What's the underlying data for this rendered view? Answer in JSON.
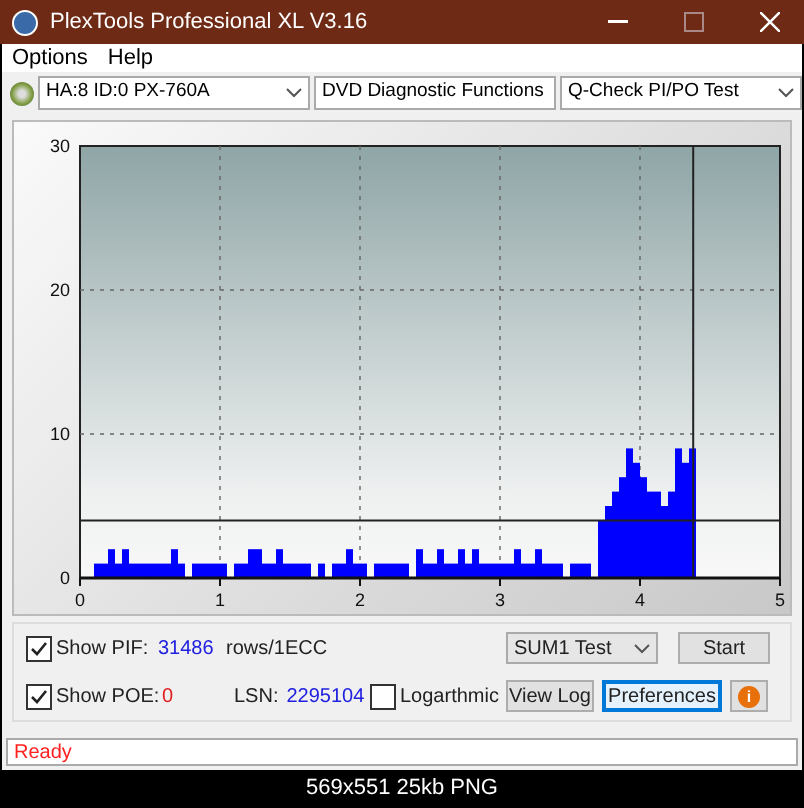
{
  "window": {
    "title": "PlexTools Professional XL V3.16"
  },
  "menu": [
    "Options",
    "Help"
  ],
  "toolbar": {
    "dropdowns": [
      "HA:8 ID:0  PX-760A",
      "DVD Diagnostic Functions",
      "Q-Check PI/PO Test"
    ]
  },
  "chart": {
    "chart_data": {
      "type": "bar",
      "xlim": [
        0,
        5
      ],
      "ylim": [
        0,
        30
      ],
      "xticks": [
        0,
        1,
        2,
        3,
        4,
        5
      ],
      "yticks": [
        0,
        10,
        20,
        30
      ],
      "x": [
        0,
        0.05,
        0.1,
        0.15,
        0.2,
        0.25,
        0.3,
        0.35,
        0.4,
        0.45,
        0.5,
        0.55,
        0.6,
        0.65,
        0.7,
        0.75,
        0.8,
        0.85,
        0.9,
        0.95,
        1,
        1.05,
        1.1,
        1.15,
        1.2,
        1.25,
        1.3,
        1.35,
        1.4,
        1.45,
        1.5,
        1.55,
        1.6,
        1.65,
        1.7,
        1.75,
        1.8,
        1.85,
        1.9,
        1.95,
        2,
        2.05,
        2.1,
        2.15,
        2.2,
        2.25,
        2.3,
        2.35,
        2.4,
        2.45,
        2.5,
        2.55,
        2.6,
        2.65,
        2.7,
        2.75,
        2.8,
        2.85,
        2.9,
        2.95,
        3,
        3.05,
        3.1,
        3.15,
        3.2,
        3.25,
        3.3,
        3.35,
        3.4,
        3.45,
        3.5,
        3.55,
        3.6,
        3.65,
        3.7,
        3.75,
        3.8,
        3.85,
        3.9,
        3.95,
        4,
        4.05,
        4.1,
        4.15,
        4.2,
        4.25,
        4.3,
        4.35
      ],
      "series": [
        {
          "color": "#0000ff",
          "values": [
            0,
            0,
            1,
            1,
            2,
            1,
            2,
            1,
            1,
            1,
            1,
            1,
            1,
            2,
            1,
            0,
            1,
            1,
            1,
            1,
            1,
            0,
            1,
            1,
            2,
            2,
            1,
            1,
            2,
            1,
            1,
            1,
            1,
            0,
            1,
            0,
            1,
            1,
            2,
            1,
            1,
            0,
            1,
            1,
            1,
            1,
            1,
            0,
            2,
            1,
            1,
            2,
            1,
            1,
            2,
            1,
            2,
            1,
            1,
            1,
            1,
            1,
            2,
            1,
            1,
            2,
            1,
            1,
            1,
            0,
            1,
            1,
            1,
            0,
            4,
            5,
            6,
            7,
            9,
            8,
            7,
            6,
            6,
            5,
            6,
            9,
            8,
            9
          ]
        }
      ],
      "grid": true,
      "ref_lines": [
        {
          "axis": "y",
          "value": 4
        },
        {
          "axis": "x",
          "value": 4.38
        }
      ]
    }
  },
  "controls": {
    "pif": {
      "label": "Show PIF:",
      "checked": true,
      "value": "31486",
      "unit": "rows/1ECC"
    },
    "poe": {
      "label": "Show POE:",
      "checked": true,
      "value": "0"
    },
    "lsn": {
      "label": "LSN:",
      "value": "2295104"
    },
    "logarithmic": {
      "label": "Logarthmic",
      "checked": false
    },
    "test_select": "SUM1 Test",
    "buttons": [
      {
        "kind": "text",
        "label": "Start",
        "focused": false
      },
      {
        "kind": "text",
        "label": "View Log",
        "focused": false
      },
      {
        "kind": "text",
        "label": "Preferences",
        "focused": true
      },
      {
        "kind": "info",
        "label": "i",
        "focused": false
      }
    ]
  },
  "status_bar": "Ready",
  "caption": "569x551 25kb PNG"
}
